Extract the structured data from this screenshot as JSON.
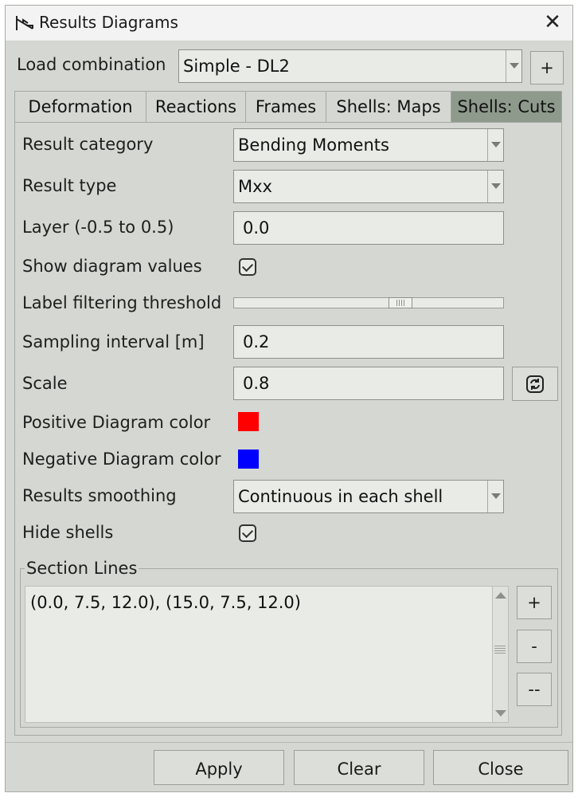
{
  "window": {
    "title": "Results Diagrams",
    "close_label": "✕"
  },
  "load_combination": {
    "label": "Load combination",
    "value": "Simple - DL2",
    "add_label": "+"
  },
  "tabs": [
    {
      "label": "Deformation",
      "active": false
    },
    {
      "label": "Reactions",
      "active": false
    },
    {
      "label": "Frames",
      "active": false
    },
    {
      "label": "Shells: Maps",
      "active": false
    },
    {
      "label": "Shells: Cuts",
      "active": true
    }
  ],
  "form": {
    "result_category": {
      "label": "Result category",
      "value": "Bending Moments"
    },
    "result_type": {
      "label": "Result type",
      "value": "Mxx"
    },
    "layer": {
      "label": "Layer (-0.5 to 0.5)",
      "value": "0.0"
    },
    "show_values": {
      "label": "Show diagram values",
      "checked": true
    },
    "label_threshold": {
      "label": "Label filtering threshold",
      "level": 0.63
    },
    "sampling_interval": {
      "label": "Sampling interval [m]",
      "value": "0.2"
    },
    "scale": {
      "label": "Scale",
      "value": "0.8"
    },
    "positive_color": {
      "label": "Positive Diagram color",
      "color": "#ff0000"
    },
    "negative_color": {
      "label": "Negative Diagram color",
      "color": "#0000ff"
    },
    "smoothing": {
      "label": "Results smoothing",
      "value": "Continuous in each shell"
    },
    "hide_shells": {
      "label": "Hide shells",
      "checked": true
    }
  },
  "section_lines": {
    "title": "Section Lines",
    "text": "(0.0, 7.5, 12.0), (15.0, 7.5, 12.0)",
    "add_label": "+",
    "remove_label": "-",
    "clear_label": "--"
  },
  "footer": {
    "apply_label": "Apply",
    "clear_label": "Clear",
    "close_label": "Close"
  },
  "colors": {
    "active_tab": "#8e9a8c",
    "window_bg": "#d5d8d2",
    "field_bg": "#e9ebe6"
  },
  "icons": [
    "app-icon",
    "close-icon",
    "refresh-icon",
    "checkbox-checked-icon"
  ]
}
